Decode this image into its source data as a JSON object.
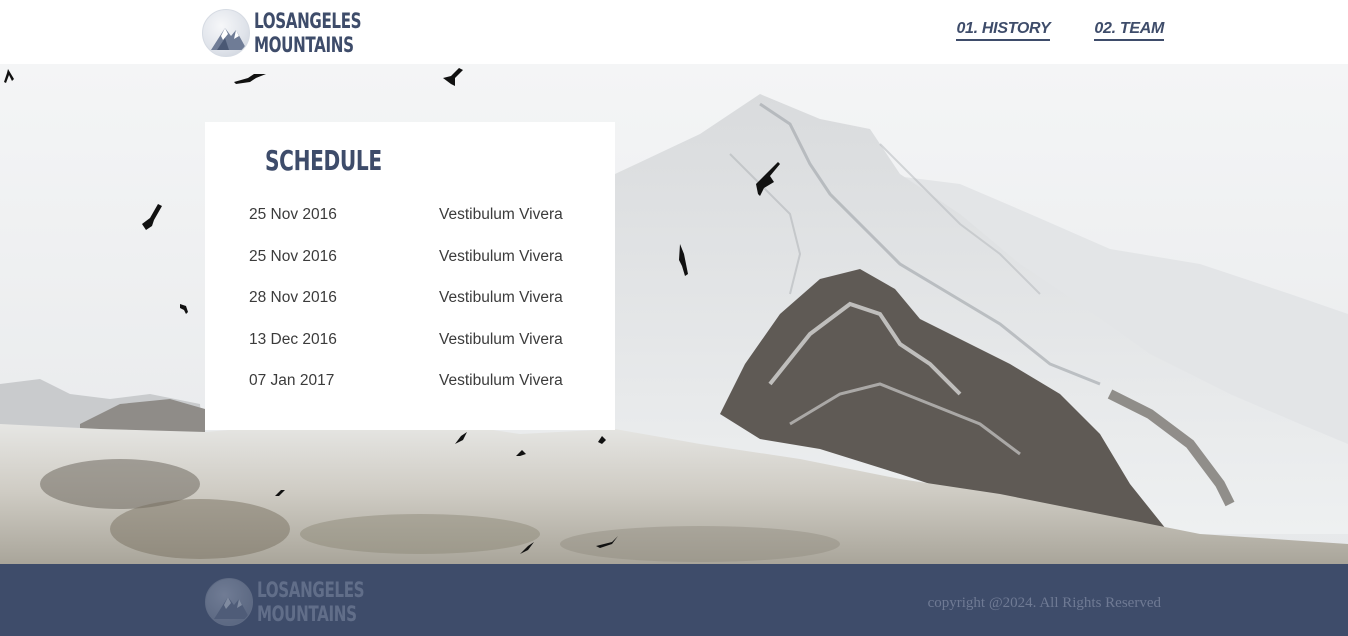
{
  "brand": {
    "line1": "LOSANGELES",
    "line2": "MOUNTAINS"
  },
  "nav": {
    "items": [
      {
        "label": "01. HISTORY"
      },
      {
        "label": "02. TEAM"
      }
    ]
  },
  "schedule": {
    "title": "SCHEDULE",
    "rows": [
      {
        "date": "25 Nov 2016",
        "event": "Vestibulum Vivera"
      },
      {
        "date": "25 Nov 2016",
        "event": "Vestibulum Vivera"
      },
      {
        "date": "28 Nov 2016",
        "event": "Vestibulum Vivera"
      },
      {
        "date": "13 Dec 2016",
        "event": "Vestibulum Vivera"
      },
      {
        "date": "07 Jan 2017",
        "event": "Vestibulum Vivera"
      }
    ]
  },
  "footer": {
    "brand_line1": "LOSANGELES",
    "brand_line2": "MOUNTAINS",
    "copyright": "copyright @2024. All Rights Reserved"
  },
  "colors": {
    "brand": "#3e4c6a",
    "footer_bg": "#3e4c6a",
    "text": "#3b3b3b"
  }
}
